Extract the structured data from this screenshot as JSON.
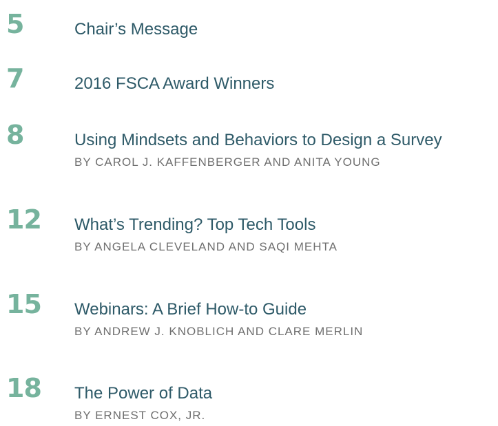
{
  "colors": {
    "number": "#76b39d",
    "title": "#2e5a68",
    "byline": "#6f6f6f"
  },
  "entries": [
    {
      "page": "5",
      "title": "Chair’s Message",
      "byline": ""
    },
    {
      "page": "7",
      "title": "2016 FSCA Award Winners",
      "byline": ""
    },
    {
      "page": "8",
      "title": "Using Mindsets and Behaviors to Design a Survey",
      "byline": "BY CAROL J. KAFFENBERGER AND ANITA YOUNG"
    },
    {
      "page": "12",
      "title": "What’s Trending? Top Tech Tools",
      "byline": "BY ANGELA CLEVELAND AND SAQI MEHTA"
    },
    {
      "page": "15",
      "title": "Webinars: A Brief How-to Guide",
      "byline": "BY ANDREW J. KNOBLICH AND CLARE MERLIN"
    },
    {
      "page": "18",
      "title": "The Power of Data",
      "byline": "BY ERNEST COX, JR."
    }
  ]
}
